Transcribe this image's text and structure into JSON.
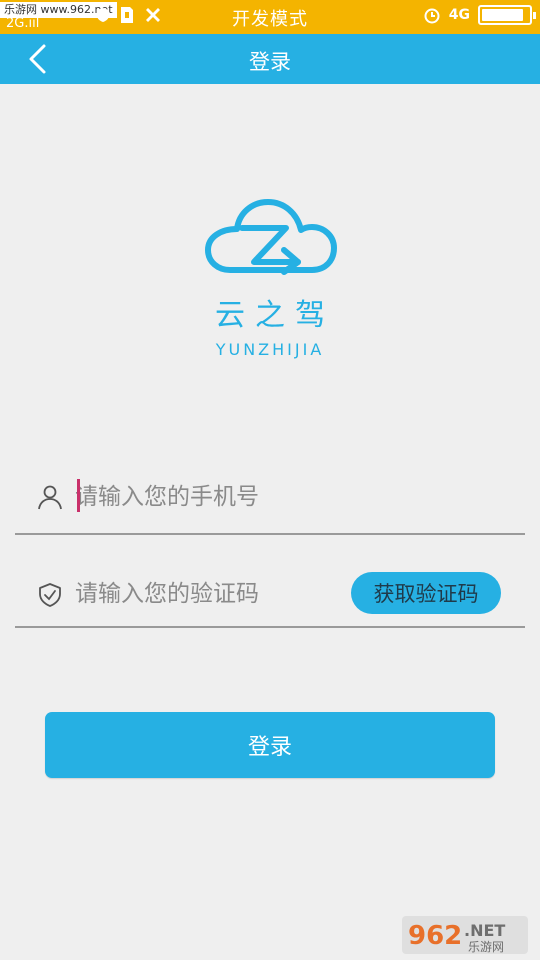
{
  "status_bar": {
    "watermark": "乐游网 www.962.net",
    "signal": "2G.ııl",
    "mode": "开发模式",
    "network": "4G",
    "battery_level": 0.9,
    "bg_color": "#f4b400",
    "icons": [
      "shield-icon",
      "sim-card-icon",
      "tools-icon",
      "alarm-icon"
    ]
  },
  "nav": {
    "title": "登录",
    "back_icon": "chevron-left-icon",
    "bg_color": "#26b0e3"
  },
  "brand": {
    "logo_icon": "cloud-arrow-logo-icon",
    "name_cn": "云之驾",
    "name_en": "YUNZHIJIA"
  },
  "form": {
    "phone": {
      "icon": "user-icon",
      "placeholder": "请输入您的手机号",
      "value": ""
    },
    "code": {
      "icon": "shield-check-icon",
      "placeholder": "请输入您的验证码",
      "value": ""
    },
    "get_code_label": "获取验证码",
    "submit_label": "登录"
  },
  "watermark_corner": {
    "number": "962",
    "suffix": ".NET",
    "site": "乐游网"
  }
}
